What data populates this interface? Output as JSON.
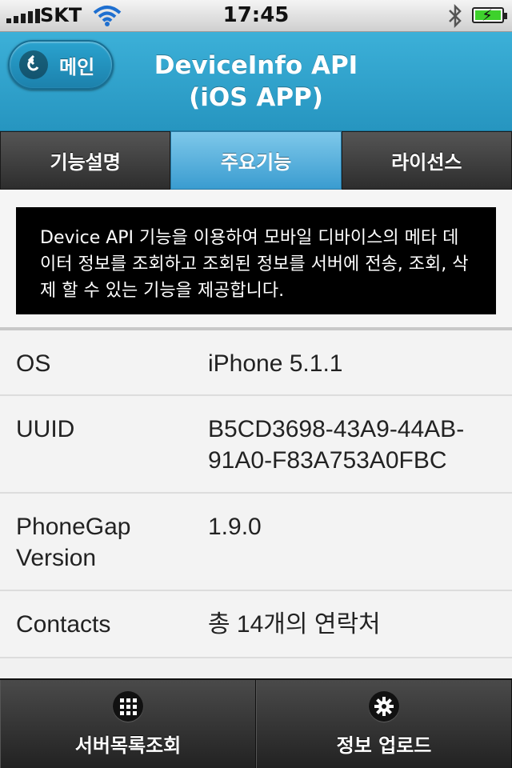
{
  "status_bar": {
    "carrier": "SKT",
    "time": "17:45"
  },
  "header": {
    "back_label": "메인",
    "title_line1": "DeviceInfo API",
    "title_line2": "(iOS APP)"
  },
  "tabs": [
    {
      "label": "기능설명",
      "active": false
    },
    {
      "label": "주요기능",
      "active": true
    },
    {
      "label": "라이선스",
      "active": false
    }
  ],
  "description": "Device API 기능을 이용하여 모바일 디바이스의 메타 데이터 정보를 조회하고 조회된 정보를 서버에 전송, 조회, 삭제 할 수 있는 기능을 제공합니다.",
  "info": [
    {
      "label": "OS",
      "value": "iPhone 5.1.1"
    },
    {
      "label": "UUID",
      "value": "B5CD3698-43A9-44AB-91A0-F83A753A0FBC"
    },
    {
      "label": "PhoneGap Version",
      "value": "1.9.0"
    },
    {
      "label": "Contacts",
      "value": "총 14개의 연락처"
    }
  ],
  "bottom_bar": {
    "left_label": "서버목록조회",
    "left_icon": "grid-icon",
    "right_label": "정보 업로드",
    "right_icon": "gear-icon"
  },
  "colors": {
    "header": "#2aa0cc",
    "active_tab": "#5bb4e0",
    "battery": "#3ed12c"
  }
}
